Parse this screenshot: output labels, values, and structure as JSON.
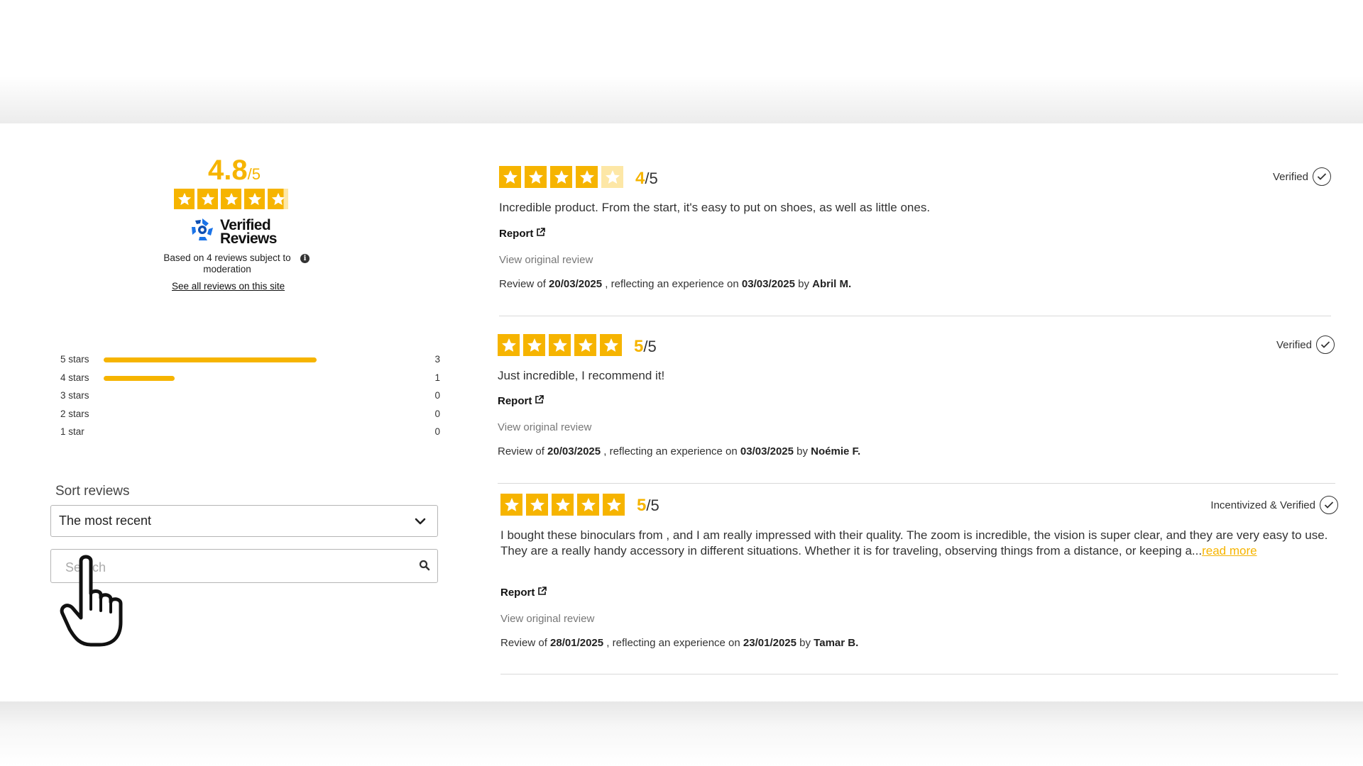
{
  "summary": {
    "average": "4.8",
    "out_of": "/5",
    "average_value": 4.8,
    "brand_line1": "Verified",
    "brand_line2": "Reviews",
    "based_on": "Based on 4 reviews subject to moderation",
    "see_all": "See all reviews on this site"
  },
  "distribution": [
    {
      "label": "5 stars",
      "count": "3",
      "fraction": 0.75
    },
    {
      "label": "4 stars",
      "count": "1",
      "fraction": 0.25
    },
    {
      "label": "3 stars",
      "count": "0",
      "fraction": 0
    },
    {
      "label": "2 stars",
      "count": "0",
      "fraction": 0
    },
    {
      "label": "1 star",
      "count": "0",
      "fraction": 0
    }
  ],
  "sort": {
    "label": "Sort reviews",
    "selected": "The most recent"
  },
  "search": {
    "placeholder": "Search"
  },
  "reviews": [
    {
      "rating": 4,
      "score": "4",
      "out_of": "/5",
      "status": "Verified",
      "text": "Incredible product. From the start, it's easy to put on shoes, as well as little ones.",
      "read_more": "",
      "report": "Report",
      "view_original": "View original review",
      "meta_prefix": "Review of ",
      "review_date": "20/03/2025",
      "meta_mid": " , reflecting an experience on ",
      "experience_date": "03/03/2025",
      "meta_by": " by ",
      "author": "Abril M."
    },
    {
      "rating": 5,
      "score": "5",
      "out_of": "/5",
      "status": "Verified",
      "text": "Just incredible, I recommend it!",
      "read_more": "",
      "report": "Report",
      "view_original": "View original review",
      "meta_prefix": "Review of ",
      "review_date": "20/03/2025",
      "meta_mid": " , reflecting an experience on ",
      "experience_date": "03/03/2025",
      "meta_by": " by ",
      "author": "Noémie F."
    },
    {
      "rating": 5,
      "score": "5",
      "out_of": "/5",
      "status": "Incentivized & Verified",
      "text": "I bought these binoculars from           , and I am really impressed with their quality. The zoom is incredible, the vision is super clear, and they are very easy to use. They are a really handy accessory in different situations. Whether it is for traveling, observing things from a distance, or keeping a...",
      "read_more": "read more",
      "report": "Report",
      "view_original": "View original review",
      "meta_prefix": "Review of ",
      "review_date": "28/01/2025",
      "meta_mid": " , reflecting an experience on ",
      "experience_date": "23/01/2025",
      "meta_by": " by ",
      "author": "Tamar B."
    }
  ],
  "colors": {
    "accent": "#f6b400",
    "accent_light": "#fde7a6",
    "brand_blue": "#1a73e8"
  },
  "icons": {
    "star": "star-icon",
    "info": "info-icon",
    "chevron": "chevron-down-icon",
    "search": "search-icon",
    "check": "check-circle-icon",
    "external": "external-link-icon",
    "cursor": "hand-cursor-icon",
    "logo": "verified-reviews-logo-icon"
  }
}
